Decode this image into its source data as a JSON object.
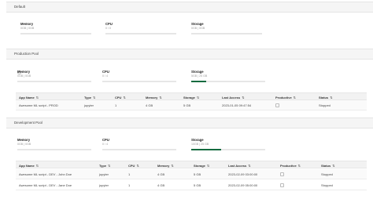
{
  "pools": [
    {
      "title": "Default",
      "metrics": {
        "memory": {
          "label": "Memory",
          "value": "0GB | 0GB",
          "fill_percent": 0
        },
        "cpu": {
          "label": "CPU",
          "value": "0 / 0",
          "fill_percent": 0
        },
        "storage": {
          "label": "Storage",
          "value": "0GB | 0GB",
          "fill_percent": 0
        }
      }
    },
    {
      "title": "Production Pool",
      "metrics": {
        "memory": {
          "label": "Memory",
          "value": "0GB | 0GB",
          "fill_percent": 0
        },
        "cpu": {
          "label": "CPU",
          "value": "0 / 4",
          "fill_percent": 0
        },
        "storage": {
          "label": "Storage",
          "value": "5GB | 25 GB",
          "fill_percent": 20
        }
      },
      "table": {
        "headers": {
          "app_name": "App Name",
          "type": "Type",
          "cpu": "CPU",
          "memory": "Memory",
          "storage": "Storage",
          "last_access": "Last Access",
          "productive": "Productive",
          "status": "Status"
        },
        "rows": [
          {
            "app_name": "Awesome ML script - PROD",
            "type": "jupyter",
            "cpu": "1",
            "memory": "4 GB",
            "storage": "5 GB",
            "last_access": "2023-01-05 09:47:54",
            "status": "Stopped"
          }
        ]
      }
    },
    {
      "title": "Development Pool",
      "metrics": {
        "memory": {
          "label": "Memory",
          "value": "0GB | 0GB",
          "fill_percent": 0
        },
        "cpu": {
          "label": "CPU",
          "value": "0 / 4",
          "fill_percent": 0
        },
        "storage": {
          "label": "Storage",
          "value": "10GB | 25 GB",
          "fill_percent": 40
        }
      },
      "table": {
        "headers": {
          "app_name": "App Name",
          "type": "Type",
          "cpu": "CPU",
          "memory": "Memory",
          "storage": "Storage",
          "last_access": "Last Access",
          "productive": "Productive",
          "status": "Status"
        },
        "rows": [
          {
            "app_name": "Awesome ML script - DEV - John Doe",
            "type": "jupyter",
            "cpu": "1",
            "memory": "4 GB",
            "storage": "5 GB",
            "last_access": "2023-02-09 03:00:00",
            "status": "Stopped"
          },
          {
            "app_name": "Awesome ML script - DEV - Jane Doe",
            "type": "jupyter",
            "cpu": "1",
            "memory": "4 GB",
            "storage": "5 GB",
            "last_access": "2023-02-09 05:00:00",
            "status": "Stopped"
          }
        ]
      }
    }
  ],
  "sort_icon": "⇅",
  "colors": {
    "accent": "#146b3f",
    "bar_track": "#e6e6e6",
    "header_bg": "#f5f5f5"
  }
}
